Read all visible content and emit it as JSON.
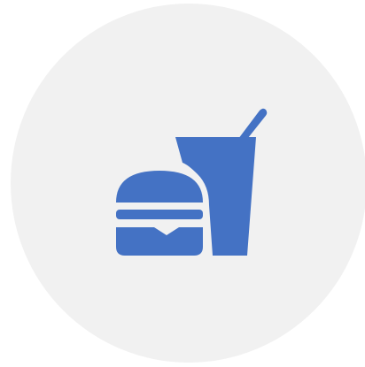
{
  "icon": {
    "name": "fast-food-icon",
    "color": "#4472c4"
  },
  "background": {
    "circle_color": "#f1f1f1",
    "page_color": "#ffffff"
  }
}
